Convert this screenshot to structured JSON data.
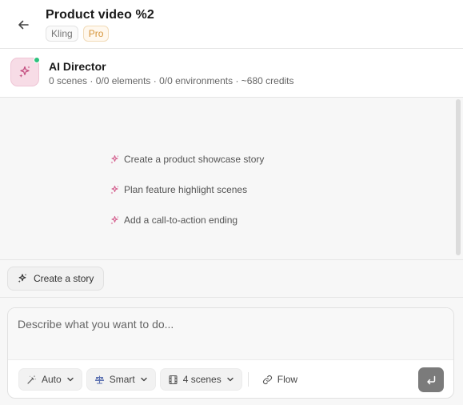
{
  "header": {
    "title": "Product video %2",
    "badges": {
      "model": "Kling",
      "tier": "Pro"
    }
  },
  "director": {
    "name": "AI Director",
    "meta": "0 scenes · 0/0 elements · 0/0 environments · ~680 credits",
    "status_color": "#2ec27e"
  },
  "suggestions": [
    {
      "label": "Create a product showcase story",
      "icon": "sparkle-icon"
    },
    {
      "label": "Plan feature highlight scenes",
      "icon": "sparkle-icon"
    },
    {
      "label": "Add a call-to-action ending",
      "icon": "sparkle-icon"
    }
  ],
  "actions": {
    "create_story": "Create a story"
  },
  "composer": {
    "placeholder": "Describe what you want to do...",
    "tools": {
      "mode": "Auto",
      "quality": "Smart",
      "scenes": "4 scenes",
      "flow": "Flow"
    }
  },
  "colors": {
    "accent_pink": "#d4608f",
    "pro_badge": "#d6953a",
    "send_button": "#7b7b7b"
  }
}
